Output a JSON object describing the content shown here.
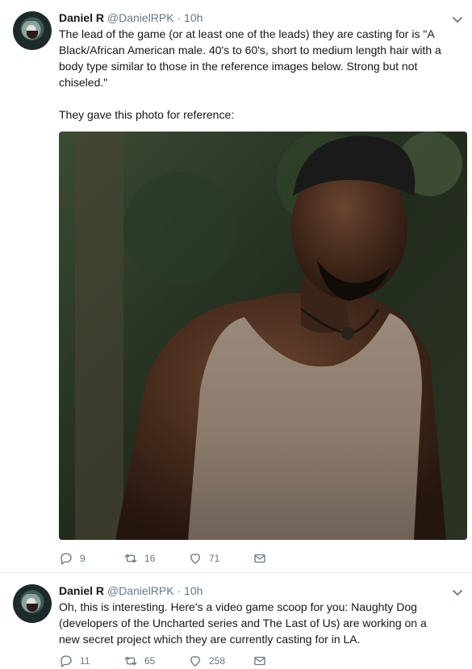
{
  "tweets": [
    {
      "name": "Daniel R",
      "handle": "@DanielRPK",
      "separator": "·",
      "time": "10h",
      "text": "The lead of the game (or at least one of the leads) they are casting for is \"A Black/African American male. 40's to 60's, short to medium length hair with a body type similar to those in the reference images below. Strong but not chiseled.\"\n\nThey gave this photo for reference:",
      "replies": "9",
      "retweets": "16",
      "likes": "71"
    },
    {
      "name": "Daniel R",
      "handle": "@DanielRPK",
      "separator": "·",
      "time": "10h",
      "text": "Oh, this is interesting. Here's a video game scoop for you: Naughty Dog (developers of the Uncharted series and The Last of Us) are working on a new secret project which they are currently casting for in LA.",
      "replies": "11",
      "retweets": "65",
      "likes": "258"
    }
  ],
  "colors": {
    "text": "#14171a",
    "muted": "#657786",
    "divider": "#e6ecf0"
  },
  "icons": [
    "avatar",
    "chevron-down-icon",
    "reply-icon",
    "retweet-icon",
    "like-icon",
    "message-icon"
  ]
}
